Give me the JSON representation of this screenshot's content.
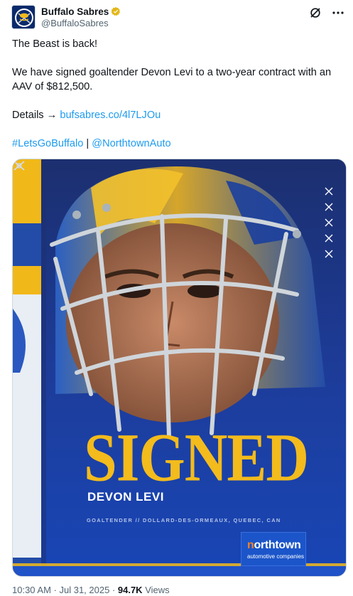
{
  "author": {
    "display_name": "Buffalo Sabres",
    "handle": "@BuffaloSabres",
    "verified": true,
    "avatar_icon": "buffalo-swords-logo"
  },
  "header_icons": [
    "grok-icon",
    "more-icon"
  ],
  "post": {
    "line1": "The Beast is back!",
    "line2": "We have signed goaltender Devon Levi to a two-year contract with an AAV of $812,500.",
    "details_label": "Details →",
    "details_link": "bufsabres.co/4l7LJOu",
    "hashtag": "#LetsGoBuffalo",
    "separator": "|",
    "mention": "@NorthtownAuto"
  },
  "media": {
    "headline": "SIGNED",
    "player_name": "DEVON LEVI",
    "position_line": "GOALTENDER  //  DOLLARD-DES-ORMEAUX, QUEBEC, CAN",
    "sponsor_brand_n": "n",
    "sponsor_brand_rest": "orthtown",
    "sponsor_sub": "automotive companies"
  },
  "meta": {
    "time": "10:30 AM · Jul 31, 2025 · ",
    "views_count": "94.7K",
    "views_label": " Views"
  },
  "colors": {
    "link": "#1d9bf0",
    "secondary_text": "#536471",
    "sabres_gold": "#f3bb1c",
    "sabres_blue": "#1a3ea0",
    "verified_gold": "#e2b719"
  }
}
